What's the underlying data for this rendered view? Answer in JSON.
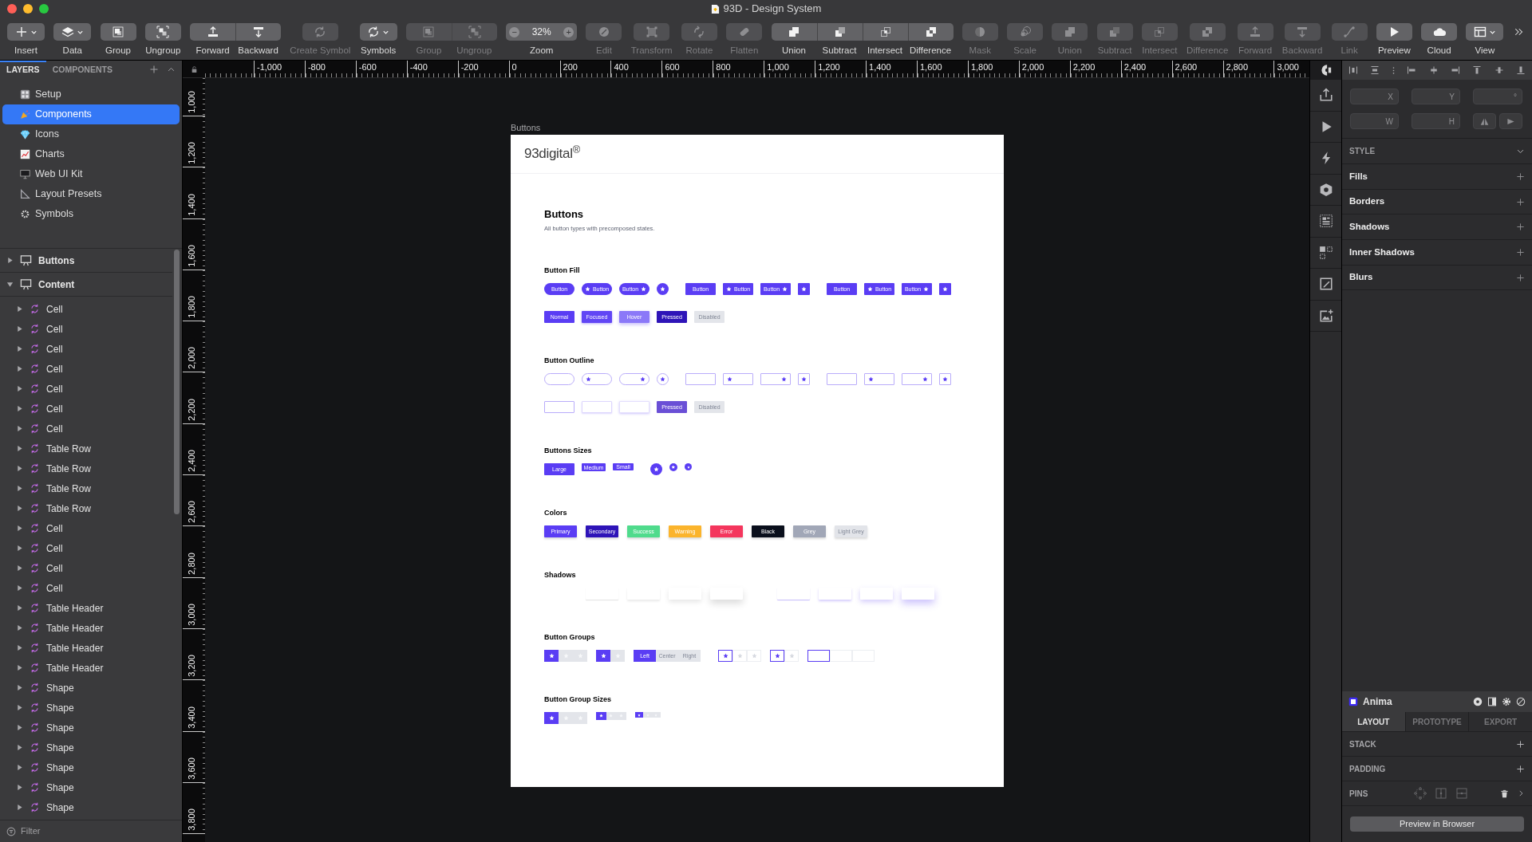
{
  "window": {
    "title": "93D - Design System"
  },
  "toolbar": {
    "items": [
      {
        "kind": "dropdown",
        "label": "Insert",
        "disabled": false
      },
      {
        "kind": "dropdown",
        "label": "Data",
        "disabled": false
      },
      {
        "kind": "button",
        "label": "Group",
        "disabled": false
      },
      {
        "kind": "button",
        "label": "Ungroup",
        "disabled": false
      },
      {
        "kind": "segmented",
        "segments": [
          {
            "label": "Forward",
            "disabled": false
          },
          {
            "label": "Backward",
            "disabled": false
          }
        ]
      },
      {
        "kind": "button",
        "label": "Create Symbol",
        "disabled": true
      },
      {
        "kind": "dropdown",
        "label": "Symbols",
        "disabled": false
      },
      {
        "kind": "segmented",
        "segments": [
          {
            "label": "Group",
            "disabled": true
          },
          {
            "label": "Ungroup",
            "disabled": true
          }
        ]
      },
      {
        "kind": "zoom",
        "label": "Zoom",
        "value": "32%",
        "minus": "−",
        "plus": "+"
      },
      {
        "kind": "button",
        "label": "Edit",
        "disabled": true
      },
      {
        "kind": "button",
        "label": "Transform",
        "disabled": true
      },
      {
        "kind": "button",
        "label": "Rotate",
        "disabled": true
      },
      {
        "kind": "button",
        "label": "Flatten",
        "disabled": true
      },
      {
        "kind": "segmented",
        "segments": [
          {
            "label": "Union",
            "disabled": false
          },
          {
            "label": "Subtract",
            "disabled": false
          },
          {
            "label": "Intersect",
            "disabled": false
          },
          {
            "label": "Difference",
            "disabled": false
          }
        ]
      },
      {
        "kind": "button",
        "label": "Mask",
        "disabled": true
      },
      {
        "kind": "button",
        "label": "Scale",
        "disabled": true
      },
      {
        "kind": "button",
        "label": "Union",
        "disabled": true
      },
      {
        "kind": "button",
        "label": "Subtract",
        "disabled": true
      },
      {
        "kind": "button",
        "label": "Intersect",
        "disabled": true
      },
      {
        "kind": "button",
        "label": "Difference",
        "disabled": true
      },
      {
        "kind": "button",
        "label": "Forward",
        "disabled": true
      },
      {
        "kind": "button",
        "label": "Backward",
        "disabled": true
      },
      {
        "kind": "button",
        "label": "Link",
        "disabled": true
      },
      {
        "kind": "button",
        "label": "Preview",
        "disabled": false
      },
      {
        "kind": "button",
        "label": "Cloud",
        "disabled": false
      },
      {
        "kind": "dropdown",
        "label": "View",
        "disabled": false
      },
      {
        "kind": "overflow"
      }
    ]
  },
  "sidebar": {
    "tabs": [
      {
        "label": "LAYERS",
        "selected": true
      },
      {
        "label": "COMPONENTS",
        "selected": false
      }
    ],
    "pages": [
      {
        "name": "Setup",
        "selected": false
      },
      {
        "name": "Components",
        "selected": true
      },
      {
        "name": "Icons",
        "selected": false
      },
      {
        "name": "Charts",
        "selected": false
      },
      {
        "name": "Web UI Kit",
        "selected": false
      },
      {
        "name": "Layout Presets",
        "selected": false
      },
      {
        "name": "Symbols",
        "selected": false
      }
    ],
    "layers": [
      {
        "name": "Buttons",
        "expanded": false
      },
      {
        "name": "Content",
        "expanded": true,
        "children": [
          {
            "name": "Cell",
            "expanded": false
          },
          {
            "name": "Cell",
            "expanded": false
          },
          {
            "name": "Cell",
            "expanded": false
          },
          {
            "name": "Cell",
            "expanded": false
          },
          {
            "name": "Cell",
            "expanded": false
          },
          {
            "name": "Cell",
            "expanded": false
          },
          {
            "name": "Cell",
            "expanded": false
          },
          {
            "name": "Table Row",
            "expanded": false
          },
          {
            "name": "Table Row",
            "expanded": false
          },
          {
            "name": "Table Row",
            "expanded": false
          },
          {
            "name": "Table Row",
            "expanded": false
          },
          {
            "name": "Cell",
            "expanded": false
          },
          {
            "name": "Cell",
            "expanded": false
          },
          {
            "name": "Cell",
            "expanded": false
          },
          {
            "name": "Cell",
            "expanded": false
          },
          {
            "name": "Table Header",
            "expanded": false
          },
          {
            "name": "Table Header",
            "expanded": false
          },
          {
            "name": "Table Header",
            "expanded": false
          },
          {
            "name": "Table Header",
            "expanded": false
          },
          {
            "name": "Shape",
            "expanded": false
          },
          {
            "name": "Shape",
            "expanded": false
          },
          {
            "name": "Shape",
            "expanded": false
          },
          {
            "name": "Shape",
            "expanded": false
          },
          {
            "name": "Shape",
            "expanded": false
          },
          {
            "name": "Shape",
            "expanded": false
          },
          {
            "name": "Shape",
            "expanded": false
          }
        ]
      }
    ],
    "filter": {
      "placeholder": "Filter"
    }
  },
  "rulers": {
    "horizontal": [
      "-1,000",
      "-800",
      "-600",
      "-400",
      "-200",
      "0",
      "200",
      "400",
      "600",
      "800",
      "1,000",
      "1,200",
      "1,400",
      "1,600",
      "1,800",
      "2,000",
      "2,200",
      "2,400",
      "2,600",
      "2,800",
      "3,000"
    ],
    "vertical": [
      "1,000",
      "1,200",
      "1,400",
      "1,600",
      "1,800",
      "2,000",
      "2,200",
      "2,400",
      "2,600",
      "2,800",
      "3,000",
      "3,200",
      "3,400",
      "3,600",
      "3,800"
    ]
  },
  "canvas": {
    "artboard_label": "Buttons",
    "artboard": {
      "logo": "93digital$^{®}$",
      "title": "Buttons",
      "subtitle": "All button types with precomposed states.",
      "sections": [
        {
          "kind": "fill-buttons",
          "title": "Button Fill",
          "rows": [
            {
              "kind": "variants",
              "groups": [
                {
                  "kind": "pill",
                  "items": [
                    {
                      "kind": "text",
                      "label": "Button"
                    },
                    {
                      "kind": "icon-left",
                      "label": "Button"
                    },
                    {
                      "kind": "icon-right",
                      "label": "Button"
                    },
                    {
                      "kind": "icon"
                    }
                  ]
                },
                {
                  "kind": "square",
                  "items": [
                    {
                      "kind": "text",
                      "label": "Button"
                    },
                    {
                      "kind": "icon-left",
                      "label": "Button"
                    },
                    {
                      "kind": "icon-right",
                      "label": "Button"
                    },
                    {
                      "kind": "icon"
                    }
                  ]
                },
                {
                  "kind": "square",
                  "items": [
                    {
                      "kind": "text",
                      "label": "Button"
                    },
                    {
                      "kind": "icon-left",
                      "label": "Button"
                    },
                    {
                      "kind": "icon-right",
                      "label": "Button"
                    },
                    {
                      "kind": "icon"
                    }
                  ]
                }
              ]
            },
            {
              "kind": "states",
              "groups": [
                {
                  "kind": "square",
                  "items": [
                    {
                      "kind": "normal",
                      "label": "Normal"
                    },
                    {
                      "kind": "focused",
                      "label": "Focused"
                    },
                    {
                      "kind": "hover",
                      "label": "Hover"
                    },
                    {
                      "kind": "pressed",
                      "label": "Pressed"
                    },
                    {
                      "kind": "disabled",
                      "label": "Disabled"
                    }
                  ]
                }
              ]
            }
          ]
        },
        {
          "kind": "outline-buttons",
          "title": "Button Outline",
          "rows": [
            {
              "kind": "variants",
              "groups": [
                {
                  "kind": "pill",
                  "items": [
                    {
                      "kind": "blank"
                    },
                    {
                      "kind": "icon-left"
                    },
                    {
                      "kind": "icon-right"
                    },
                    {
                      "kind": "icon"
                    }
                  ]
                },
                {
                  "kind": "square",
                  "items": [
                    {
                      "kind": "blank"
                    },
                    {
                      "kind": "icon-left"
                    },
                    {
                      "kind": "icon-right"
                    },
                    {
                      "kind": "icon"
                    }
                  ]
                },
                {
                  "kind": "square",
                  "items": [
                    {
                      "kind": "blank"
                    },
                    {
                      "kind": "icon-left"
                    },
                    {
                      "kind": "icon-right"
                    },
                    {
                      "kind": "icon"
                    }
                  ]
                }
              ]
            },
            {
              "kind": "states",
              "groups": [
                {
                  "kind": "square",
                  "items": [
                    {
                      "kind": "normal"
                    },
                    {
                      "kind": "focused"
                    },
                    {
                      "kind": "hover"
                    },
                    {
                      "kind": "pressed",
                      "label": "Pressed"
                    },
                    {
                      "kind": "disabled",
                      "label": "Disabled"
                    }
                  ]
                }
              ]
            }
          ]
        },
        {
          "kind": "size-buttons",
          "title": "Buttons Sizes",
          "rows": [
            {
              "kind": "variants",
              "groups": [
                {
                  "kind": "square",
                  "items": [
                    {
                      "kind": "text",
                      "label": "Large"
                    },
                    {
                      "kind": "text",
                      "label": "Medium"
                    },
                    {
                      "kind": "text",
                      "label": "Small"
                    }
                  ]
                },
                {
                  "kind": "pill",
                  "items": [
                    {
                      "kind": "icon"
                    },
                    {
                      "kind": "icon"
                    },
                    {
                      "kind": "icon"
                    }
                  ]
                }
              ]
            }
          ]
        },
        {
          "kind": "colors",
          "title": "Colors",
          "items": [
            {
              "label": "Primary",
              "color": "#5a3df4"
            },
            {
              "label": "Secondary",
              "color": "#2e14b8"
            },
            {
              "label": "Success",
              "color": "#4fdb8c"
            },
            {
              "label": "Warning",
              "color": "#fbb42c"
            },
            {
              "label": "Error",
              "color": "#f4365d"
            },
            {
              "label": "Black",
              "color": "#0a0f1c"
            },
            {
              "label": "Grey",
              "color": "#a1a7b7"
            },
            {
              "label": "Light Grey",
              "color": "#e2e4e9"
            }
          ]
        },
        {
          "kind": "shadows",
          "title": "Shadows",
          "groups": [
            {
              "kind": "neutral",
              "items": [
                {
                  "kind": "xs"
                },
                {
                  "kind": "sm"
                },
                {
                  "kind": "md"
                },
                {
                  "kind": "lg"
                }
              ]
            },
            {
              "kind": "primary",
              "items": [
                {
                  "kind": "xs"
                },
                {
                  "kind": "sm"
                },
                {
                  "kind": "md"
                },
                {
                  "kind": "lg"
                }
              ]
            }
          ]
        },
        {
          "kind": "groups",
          "title": "Button Groups",
          "groups": [
            {
              "kind": "fill",
              "segments": [
                {
                  "kind": "icon",
                  "selected": true
                },
                {
                  "kind": "icon",
                  "selected": false
                },
                {
                  "kind": "icon",
                  "selected": false
                }
              ]
            },
            {
              "kind": "fill",
              "segments": [
                {
                  "kind": "icon",
                  "selected": true
                },
                {
                  "kind": "icon",
                  "selected": false
                }
              ]
            },
            {
              "kind": "fill",
              "segments": [
                {
                  "kind": "text",
                  "label": "Left",
                  "selected": true
                },
                {
                  "kind": "text",
                  "label": "Center",
                  "selected": false
                },
                {
                  "kind": "text",
                  "label": "Right",
                  "selected": false
                }
              ]
            },
            {
              "kind": "outline",
              "segments": [
                {
                  "kind": "icon",
                  "selected": true
                },
                {
                  "kind": "icon",
                  "selected": false
                },
                {
                  "kind": "icon",
                  "selected": false
                }
              ]
            },
            {
              "kind": "outline",
              "segments": [
                {
                  "kind": "icon",
                  "selected": true
                },
                {
                  "kind": "icon",
                  "selected": false
                }
              ]
            },
            {
              "kind": "outline",
              "segments": [
                {
                  "kind": "blank",
                  "selected": true
                },
                {
                  "kind": "blank",
                  "selected": false
                },
                {
                  "kind": "blank",
                  "selected": false
                }
              ]
            }
          ]
        },
        {
          "kind": "group-sizes",
          "title": "Button Group Sizes",
          "groups": [
            {
              "kind": "fill",
              "segments": [
                {
                  "kind": "icon",
                  "selected": true
                },
                {
                  "kind": "icon",
                  "selected": false
                },
                {
                  "kind": "icon",
                  "selected": false
                }
              ]
            },
            {
              "kind": "fill",
              "segments": [
                {
                  "kind": "icon",
                  "selected": true
                },
                {
                  "kind": "icon",
                  "selected": false
                },
                {
                  "kind": "icon",
                  "selected": false
                }
              ]
            },
            {
              "kind": "fill",
              "segments": [
                {
                  "kind": "icon",
                  "selected": true
                },
                {
                  "kind": "icon",
                  "selected": false
                },
                {
                  "kind": "icon",
                  "selected": false
                }
              ]
            }
          ]
        }
      ]
    }
  },
  "inspector": {
    "fields": [
      {
        "placeholder": "X"
      },
      {
        "placeholder": "Y"
      },
      {
        "placeholder": "°"
      },
      {
        "placeholder": "W"
      },
      {
        "placeholder": "H"
      }
    ],
    "style": {
      "title": "STYLE",
      "expanded": true
    },
    "sections": [
      "Fills",
      "Borders",
      "Shadows",
      "Inner Shadows",
      "Blurs"
    ]
  },
  "anima": {
    "title": "Anima",
    "tabs": [
      {
        "label": "LAYOUT",
        "selected": true
      },
      {
        "label": "PROTOTYPE",
        "selected": false
      },
      {
        "label": "EXPORT",
        "selected": false
      }
    ],
    "rows": [
      {
        "label": "STACK",
        "kind": "add"
      },
      {
        "label": "PADDING",
        "kind": "add"
      },
      {
        "label": "PINS",
        "kind": "pins"
      }
    ],
    "button": "Preview in Browser"
  }
}
